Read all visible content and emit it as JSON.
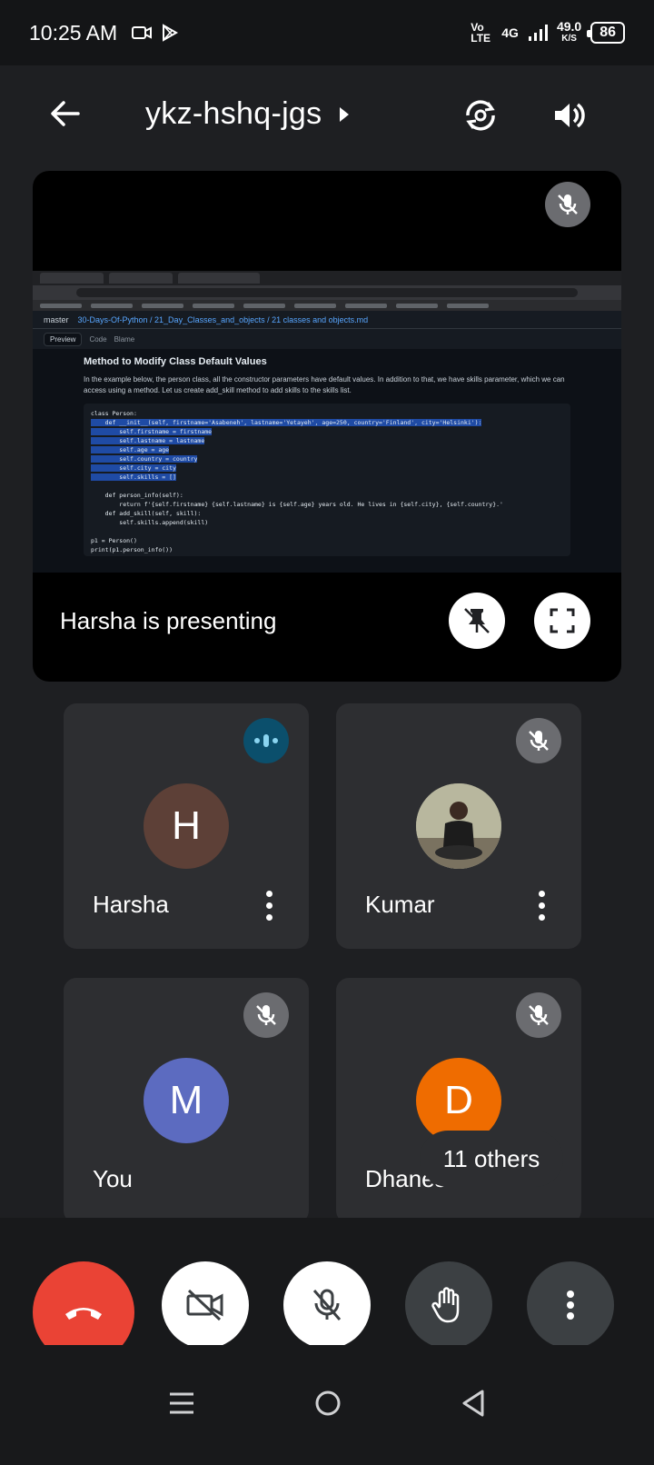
{
  "status_bar": {
    "time": "10:25 AM",
    "network": "4G",
    "lte": "Vo LTE",
    "speed": "49.0",
    "speed_unit": "K/S",
    "battery": "86"
  },
  "header": {
    "meeting_code": "ykz-hshq-jgs"
  },
  "presentation": {
    "label": "Harsha is presenting",
    "screen": {
      "breadcrumb_branch": "master",
      "breadcrumb_path": "30-Days-Of-Python / 21_Day_Classes_and_objects / 21 classes and objects.md",
      "tab_preview": "Preview",
      "tab_code": "Code",
      "tab_blame": "Blame",
      "heading": "Method to Modify Class Default Values",
      "paragraph": "In the example below, the person class, all the constructor parameters have default values. In addition to that, we have skills parameter, which we can access using a method. Let us create add_skill method to add skills to the skills list.",
      "code_lines": [
        "class Person:",
        "    def __init__(self, firstname='Asabeneh', lastname='Yetayeh', age=250, country='Finland', city='Helsinki'):",
        "        self.firstname = firstname",
        "        self.lastname = lastname",
        "        self.age = age",
        "        self.country = country",
        "        self.city = city",
        "        self.skills = []",
        "",
        "    def person_info(self):",
        "        return f'{self.firstname} {self.lastname} is {self.age} years old. He lives in {self.city}, {self.country}.'",
        "    def add_skill(self, skill):",
        "        self.skills.append(skill)",
        "",
        "p1 = Person()",
        "print(p1.person_info())"
      ]
    }
  },
  "participants": [
    {
      "name": "Harsha",
      "initial": "H",
      "color": "#5d4037",
      "speaking": true
    },
    {
      "name": "Kumar",
      "initial": "",
      "color": "#8d8f7a",
      "speaking": false
    },
    {
      "name": "You",
      "initial": "M",
      "color": "#5c6bc0",
      "speaking": false
    },
    {
      "name": "Dhanesh",
      "initial": "D",
      "color": "#ef6c00",
      "speaking": false
    }
  ],
  "others_label": "11 others",
  "colors": {
    "end_call": "#ea4335",
    "tile": "#2d2e31",
    "background": "#1e1f22"
  }
}
